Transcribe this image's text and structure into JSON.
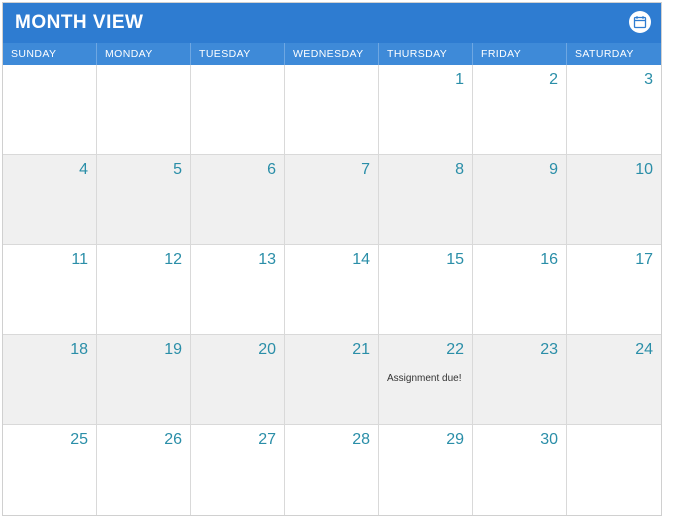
{
  "header": {
    "title": "MONTH VIEW",
    "icon": "calendar-icon"
  },
  "days_of_week": [
    "SUNDAY",
    "MONDAY",
    "TUESDAY",
    "WEDNESDAY",
    "THURSDAY",
    "FRIDAY",
    "SATURDAY"
  ],
  "cells": [
    {
      "num": "",
      "shaded": false,
      "event": ""
    },
    {
      "num": "",
      "shaded": false,
      "event": ""
    },
    {
      "num": "",
      "shaded": false,
      "event": ""
    },
    {
      "num": "",
      "shaded": false,
      "event": ""
    },
    {
      "num": "1",
      "shaded": false,
      "event": ""
    },
    {
      "num": "2",
      "shaded": false,
      "event": ""
    },
    {
      "num": "3",
      "shaded": false,
      "event": ""
    },
    {
      "num": "4",
      "shaded": true,
      "event": ""
    },
    {
      "num": "5",
      "shaded": true,
      "event": ""
    },
    {
      "num": "6",
      "shaded": true,
      "event": ""
    },
    {
      "num": "7",
      "shaded": true,
      "event": ""
    },
    {
      "num": "8",
      "shaded": true,
      "event": ""
    },
    {
      "num": "9",
      "shaded": true,
      "event": ""
    },
    {
      "num": "10",
      "shaded": true,
      "event": ""
    },
    {
      "num": "11",
      "shaded": false,
      "event": ""
    },
    {
      "num": "12",
      "shaded": false,
      "event": ""
    },
    {
      "num": "13",
      "shaded": false,
      "event": ""
    },
    {
      "num": "14",
      "shaded": false,
      "event": ""
    },
    {
      "num": "15",
      "shaded": false,
      "event": ""
    },
    {
      "num": "16",
      "shaded": false,
      "event": ""
    },
    {
      "num": "17",
      "shaded": false,
      "event": ""
    },
    {
      "num": "18",
      "shaded": true,
      "event": ""
    },
    {
      "num": "19",
      "shaded": true,
      "event": ""
    },
    {
      "num": "20",
      "shaded": true,
      "event": ""
    },
    {
      "num": "21",
      "shaded": true,
      "event": ""
    },
    {
      "num": "22",
      "shaded": true,
      "event": "Assignment due!"
    },
    {
      "num": "23",
      "shaded": true,
      "event": ""
    },
    {
      "num": "24",
      "shaded": true,
      "event": ""
    },
    {
      "num": "25",
      "shaded": false,
      "event": ""
    },
    {
      "num": "26",
      "shaded": false,
      "event": ""
    },
    {
      "num": "27",
      "shaded": false,
      "event": ""
    },
    {
      "num": "28",
      "shaded": false,
      "event": ""
    },
    {
      "num": "29",
      "shaded": false,
      "event": ""
    },
    {
      "num": "30",
      "shaded": false,
      "event": ""
    },
    {
      "num": "",
      "shaded": false,
      "event": ""
    }
  ],
  "colors": {
    "header_bg": "#2e7cd1",
    "dow_bg": "#3e8ad8",
    "date_color": "#2a8ea8",
    "shaded_bg": "#f0f0f0"
  }
}
